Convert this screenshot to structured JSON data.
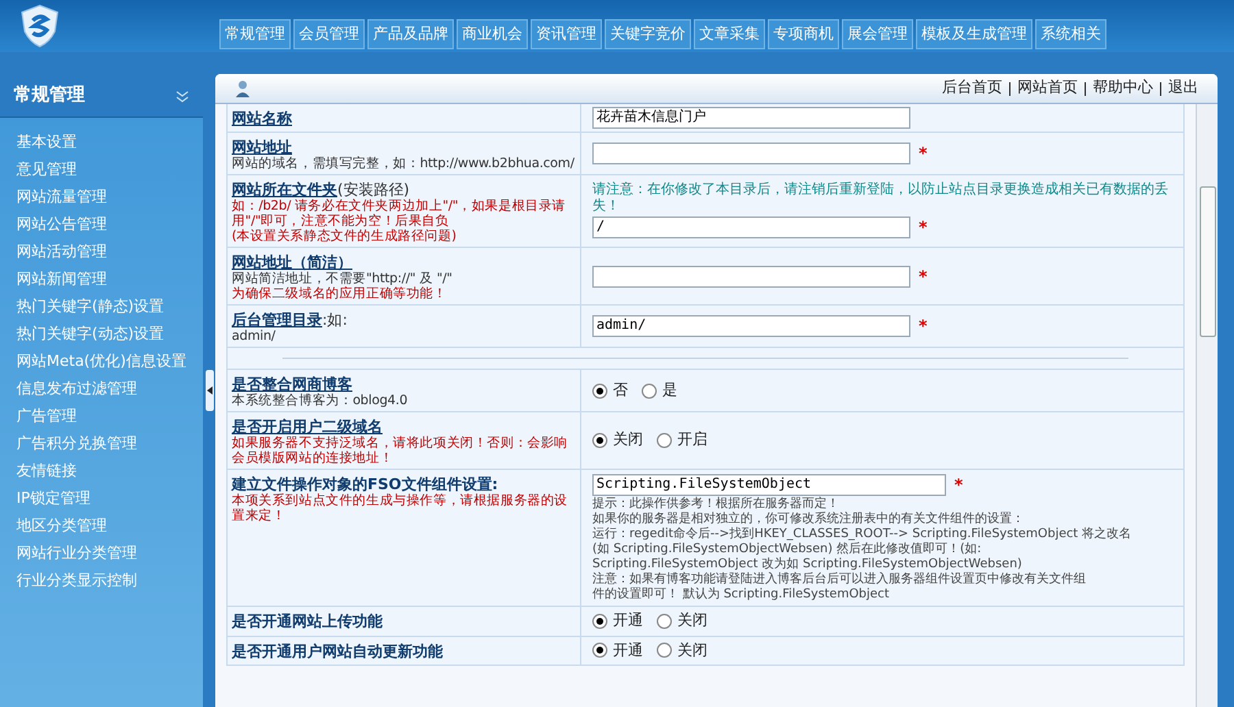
{
  "header": {
    "tabs": [
      {
        "label": "常规管理"
      },
      {
        "label": "会员管理"
      },
      {
        "label": "产品及品牌"
      },
      {
        "label": "商业机会"
      },
      {
        "label": "资讯管理"
      },
      {
        "label": "关键字竞价"
      },
      {
        "label": "文章采集"
      },
      {
        "label": "专项商机"
      },
      {
        "label": "展会管理"
      },
      {
        "label": "模板及生成管理"
      },
      {
        "label": "系统相关"
      }
    ]
  },
  "sidebar": {
    "title": "常规管理",
    "items": [
      "基本设置",
      "意见管理",
      "网站流量管理",
      "网站公告管理",
      "网站活动管理",
      "网站新闻管理",
      "热门关键字(静态)设置",
      "热门关键字(动态)设置",
      "网站Meta(优化)信息设置",
      "信息发布过滤管理",
      "广告管理",
      "广告积分兑换管理",
      "友情链接",
      "IP锁定管理",
      "地区分类管理",
      "网站行业分类管理",
      "行业分类显示控制"
    ]
  },
  "top_links": [
    "后台首页",
    "网站首页",
    "帮助中心",
    "退出"
  ],
  "settings": [
    {
      "kind": "text",
      "label": "网站名称",
      "link": true,
      "value": "花卉苗木信息门户"
    },
    {
      "kind": "text",
      "label": "网站地址",
      "link": true,
      "notes": [
        {
          "text": "网站的域名，需填写完整，如：http://www.b2bhua.com/",
          "kind": "plain"
        }
      ],
      "required_mark": "*"
    },
    {
      "kind": "text",
      "label": "网站所在文件夹",
      "label_suffix": "(安装路径)",
      "link": true,
      "notes": [
        {
          "text": "如：/b2b/ 请务必在文件夹两边加上\"/\"，如果是根目录请用\"/\"即可，注意不能为空！后果自负",
          "kind": "warning"
        },
        {
          "text": "(本设置关系静态文件的生成路径问题)",
          "kind": "warning"
        }
      ],
      "notice": "请注意：在你修改了本目录后，请注销后重新登陆，以防止站点目录更换造成相关已有数据的丢失！",
      "value": "/",
      "required_mark": "*"
    },
    {
      "kind": "text",
      "label": "网站地址（简洁）",
      "link": true,
      "notes": [
        {
          "text": "网站简洁地址，不需要\"http://\" 及 \"/\"",
          "kind": "plain"
        },
        {
          "text": "为确保二级域名的应用正确等功能！",
          "kind": "warning"
        }
      ],
      "required_mark": "*"
    },
    {
      "kind": "text",
      "label": "后台管理目录",
      "label_suffix": ":如:",
      "link": true,
      "notes": [
        {
          "text": "admin/",
          "kind": "plain"
        }
      ],
      "value": "admin/",
      "required_mark": "*"
    },
    {
      "kind": "separator"
    },
    {
      "kind": "radio",
      "label": "是否整合网商博客",
      "link": true,
      "notes": [
        {
          "text": "本系统整合博客为：oblog4.0",
          "kind": "plain"
        }
      ],
      "options": [
        {
          "label": "否",
          "selected": true
        },
        {
          "label": "是",
          "selected": false
        }
      ]
    },
    {
      "kind": "radio",
      "label": "是否开启用户二级域名",
      "link": true,
      "notes": [
        {
          "text": "如果服务器不支持泛域名，请将此项关闭！否则：会影响会员模版网站的连接地址！",
          "kind": "warning"
        }
      ],
      "options": [
        {
          "label": "关闭",
          "selected": true
        },
        {
          "label": "开启",
          "selected": false
        }
      ]
    },
    {
      "kind": "text",
      "label": "建立文件操作对象的FSO文件组件设置:",
      "link": false,
      "notes": [
        {
          "text": "本项关系到站点文件的生成与操作等，请根据服务器的设置来定！",
          "kind": "warning"
        }
      ],
      "value": "Scripting.FileSystemObject",
      "required_mark": "*",
      "hints": [
        "提示：此操作供参考！根据所在服务器而定！",
        "如果你的服务器是相对独立的，你可修改系统注册表中的有关文件组件的设置：",
        "运行：regedit命令后-->找到HKEY_CLASSES_ROOT--> Scripting.FileSystemObject 将之改名",
        "(如 Scripting.FileSystemObjectWebsen) 然后在此修改值即可！(如:",
        "Scripting.FileSystemObject 改为如 Scripting.FileSystemObjectWebsen)",
        "注意：如果有博客功能请登陆进入博客后台后可以进入服务器组件设置页中修改有关文件组",
        "件的设置即可！ 默认为 Scripting.FileSystemObject"
      ]
    },
    {
      "kind": "radio",
      "label": "是否开通网站上传功能",
      "link": false,
      "options": [
        {
          "label": "开通",
          "selected": true
        },
        {
          "label": "关闭",
          "selected": false
        }
      ]
    },
    {
      "kind": "radio",
      "label": "是否开通用户网站自动更新功能",
      "link": false,
      "options": [
        {
          "label": "开通",
          "selected": true
        },
        {
          "label": "关闭",
          "selected": false
        }
      ]
    }
  ]
}
